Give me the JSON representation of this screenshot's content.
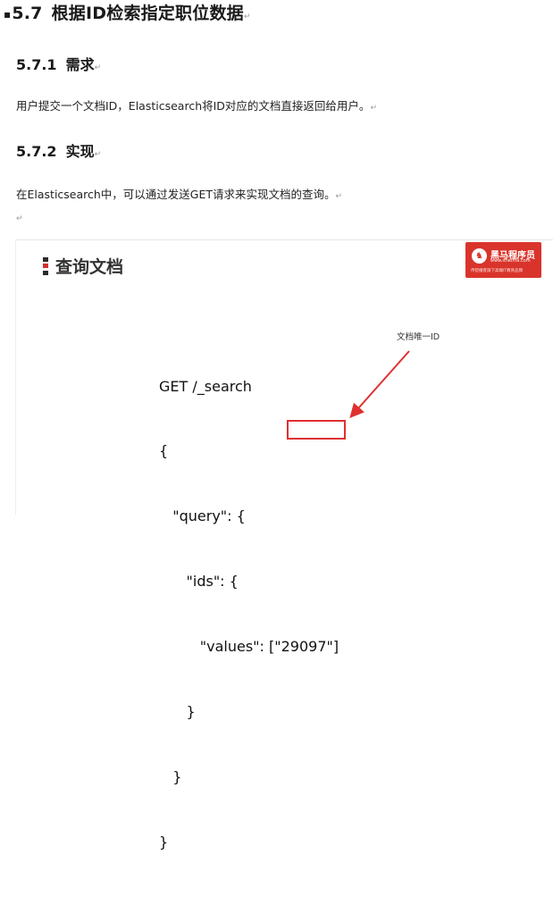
{
  "section": {
    "number": "5.7",
    "title": "根据ID检索指定职位数据"
  },
  "requirement": {
    "number": "5.7.1",
    "title": "需求",
    "text": "用户提交一个文档ID，Elasticsearch将ID对应的文档直接返回给用户。"
  },
  "implementation": {
    "number": "5.7.2",
    "title": "实现",
    "text": "在Elasticsearch中，可以通过发送GET请求来实现文档的查询。"
  },
  "paragraph_mark": "↵",
  "slide": {
    "title": "查询文档",
    "logo": {
      "name": "黑马程序员",
      "url": "www.itheima.com",
      "slogan": "传智播客旗下高端IT教育品牌"
    },
    "code_lines": [
      "GET /_search",
      "{",
      "   \"query\": {",
      "      \"ids\": {",
      "         \"values\": [\"29097\"]",
      "      }",
      "   }",
      "}"
    ],
    "annotation": "文档唯一ID",
    "colors": {
      "accent_red": "#e03030",
      "logo_red": "#d9342b"
    }
  }
}
